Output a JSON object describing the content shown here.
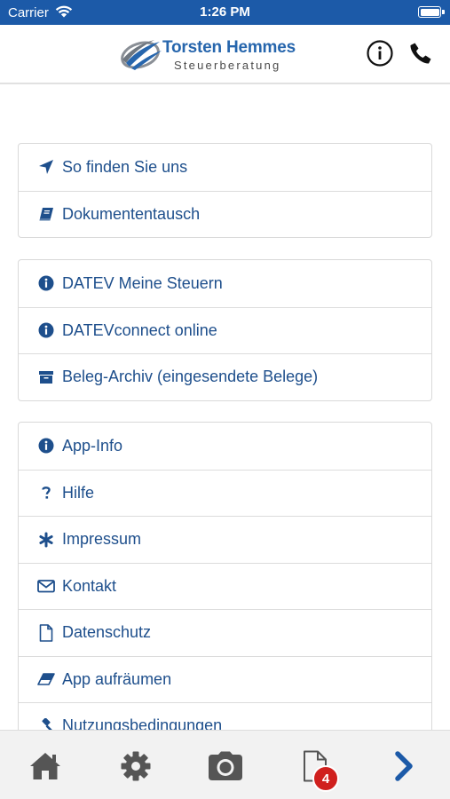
{
  "status_bar": {
    "carrier": "Carrier",
    "time": "1:26 PM"
  },
  "header": {
    "logo": {
      "name": "Torsten Hemmes",
      "subtitle": "Steuerberatung"
    },
    "info_icon": "info-circle-icon",
    "phone_icon": "phone-icon"
  },
  "menu_groups": [
    {
      "items": [
        {
          "label": "So finden Sie uns",
          "icon": "location-arrow-icon"
        },
        {
          "label": "Dokumententausch",
          "icon": "book-icon"
        }
      ]
    },
    {
      "items": [
        {
          "label": "DATEV Meine Steuern",
          "icon": "info-circle-icon"
        },
        {
          "label": "DATEVconnect online",
          "icon": "info-circle-icon"
        },
        {
          "label": "Beleg-Archiv (eingesendete Belege)",
          "icon": "archive-icon"
        }
      ]
    },
    {
      "items": [
        {
          "label": "App-Info",
          "icon": "info-circle-icon"
        },
        {
          "label": "Hilfe",
          "icon": "question-icon"
        },
        {
          "label": "Impressum",
          "icon": "asterisk-icon"
        },
        {
          "label": "Kontakt",
          "icon": "envelope-icon"
        },
        {
          "label": "Datenschutz",
          "icon": "document-icon"
        },
        {
          "label": "App aufräumen",
          "icon": "eraser-icon"
        },
        {
          "label": "Nutzungsbedingungen",
          "icon": "gavel-icon"
        }
      ]
    }
  ],
  "tab_bar": {
    "tabs": [
      {
        "icon": "home-icon"
      },
      {
        "icon": "gear-icon"
      },
      {
        "icon": "camera-icon"
      },
      {
        "icon": "document-icon"
      },
      {
        "icon": "chevron-right-icon"
      }
    ],
    "documents_badge": "4"
  },
  "colors": {
    "status_bar": "#1c5aa8",
    "accent": "#1e4f8c",
    "badge": "#d0201e",
    "tab_icon": "#555555",
    "tab_active": "#1c5aa8"
  }
}
